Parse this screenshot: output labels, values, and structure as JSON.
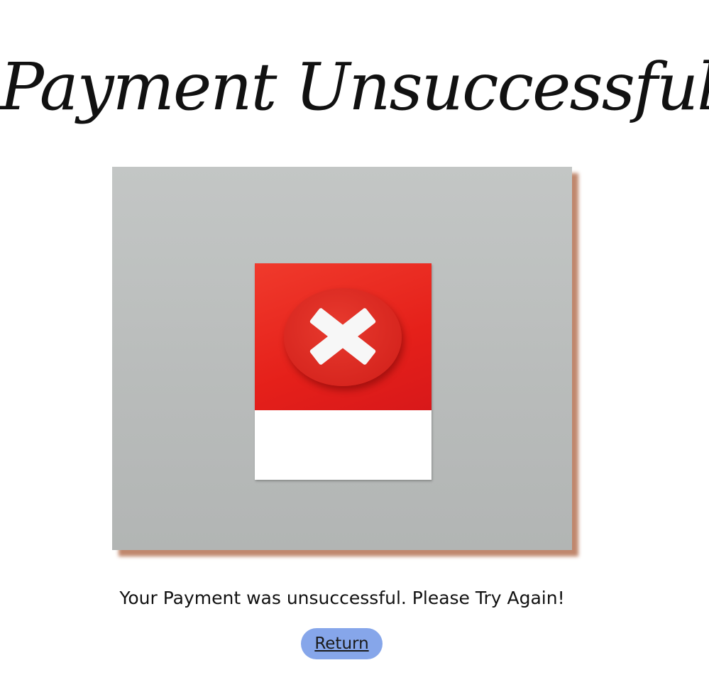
{
  "page": {
    "title": "Payment Unsuccessful",
    "message": "Your Payment was unsuccessful. Please Try Again!",
    "return_label": "Return"
  },
  "image": {
    "subject": "red paper card with white cross mark on grey background",
    "icon": "x-mark-icon"
  },
  "colors": {
    "background": "#ffffff",
    "button": "#86a6ea",
    "image_shadow": "#c0876d",
    "card_red": "#e5201a",
    "photo_grey": "#b9bcbb"
  }
}
